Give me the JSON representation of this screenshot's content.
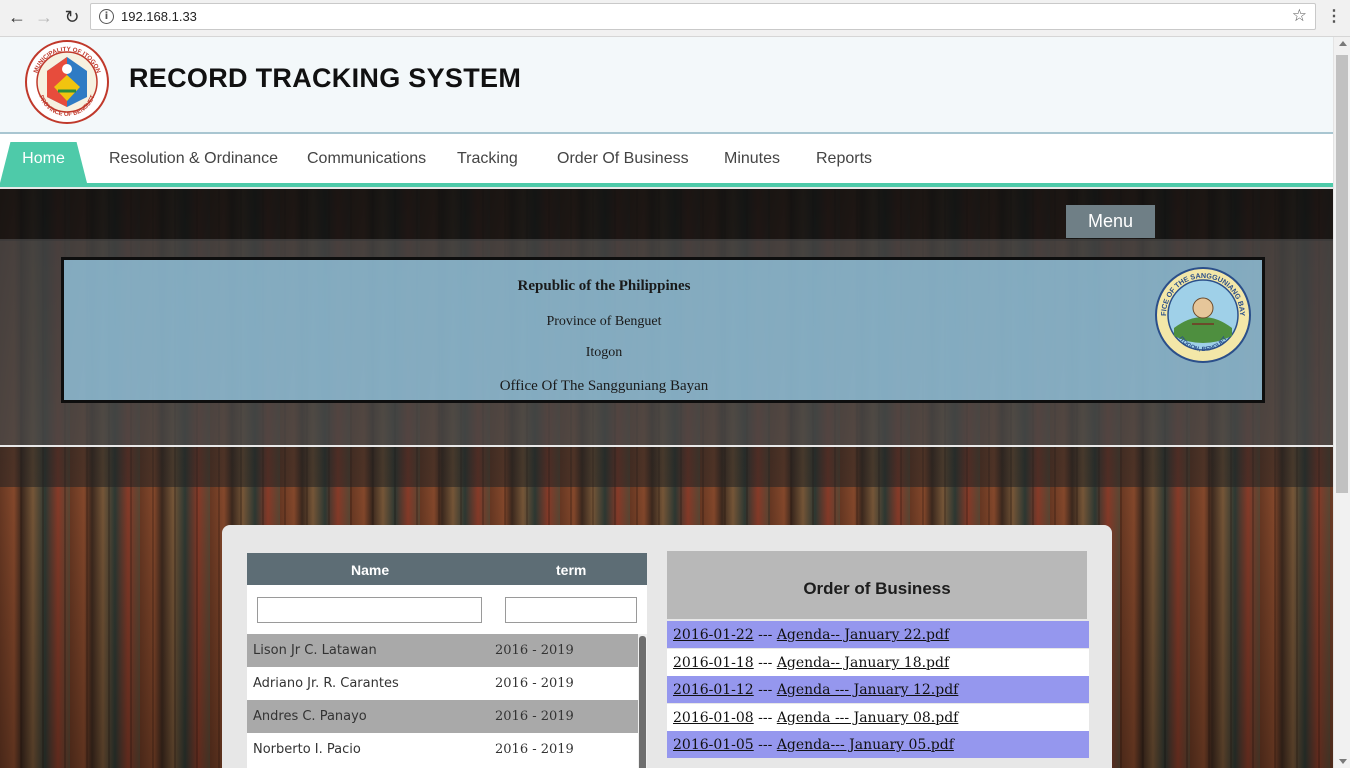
{
  "browser": {
    "url": "192.168.1.33"
  },
  "header": {
    "title": "RECORD TRACKING SYSTEM",
    "logo_texts": [
      "MUNICIPALITY OF ITOGON",
      "PROVINCE OF BENGUET"
    ]
  },
  "nav": {
    "items": [
      "Home",
      "Resolution & Ordinance",
      "Communications",
      "Tracking",
      "Order Of Business",
      "Minutes",
      "Reports"
    ]
  },
  "menu_button": "Menu",
  "gov": {
    "line1": "Republic of the Philippines",
    "line2": "Province of Benguet",
    "line3": "Itogon",
    "line4": "Office Of The Sangguniang Bayan",
    "seal_texts": [
      "OFFICE OF THE SANGGUNIANG BAYAN",
      "ITOGON, BENGUET"
    ]
  },
  "members_table": {
    "headers": {
      "name": "Name",
      "term": "term"
    },
    "rows": [
      {
        "name": "Lison Jr C. Latawan",
        "term": "2016 - 2019"
      },
      {
        "name": "Adriano Jr. R. Carantes",
        "term": "2016 - 2019"
      },
      {
        "name": "Andres C. Panayo",
        "term": "2016 - 2019"
      },
      {
        "name": "Norberto I. Pacio",
        "term": "2016 - 2019"
      }
    ]
  },
  "order_of_business": {
    "title": "Order of Business",
    "items": [
      {
        "date": "2016-01-22",
        "sep": " --- ",
        "file": "Agenda-- January 22.pdf"
      },
      {
        "date": "2016-01-18",
        "sep": " --- ",
        "file": "Agenda-- January 18.pdf"
      },
      {
        "date": "2016-01-12",
        "sep": " --- ",
        "file": "Agenda --- January 12.pdf"
      },
      {
        "date": "2016-01-08",
        "sep": " --- ",
        "file": "Agenda --- January 08.pdf"
      },
      {
        "date": "2016-01-05",
        "sep": " --- ",
        "file": "Agenda--- January 05.pdf"
      }
    ]
  },
  "colors": {
    "accent": "#4ecaa9",
    "table_header": "#5d6d75",
    "highlight_row": "#9597ee"
  }
}
